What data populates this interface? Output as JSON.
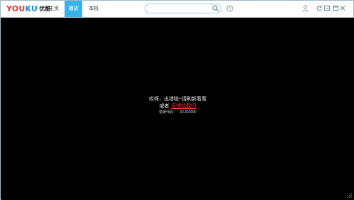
{
  "app": {
    "logo_latin_y": "YOU",
    "logo_latin_k": "KU",
    "logo_cn": "优酷",
    "brand_red": "#e5312e",
    "brand_blue": "#1b8fdc",
    "accent": "#38b2ea"
  },
  "nav": {
    "items": [
      {
        "label": "主页",
        "active": false
      },
      {
        "label": "播放",
        "active": true
      },
      {
        "label": "本机",
        "active": false
      }
    ]
  },
  "search": {
    "value": ""
  },
  "icons": {
    "search": "search-icon",
    "history": "clock-icon",
    "user": "user-icon",
    "refresh": "refresh-icon",
    "minimize": "minimize-icon",
    "window": "window-icon",
    "close": "close-icon",
    "resize": "resize-grip-icon"
  },
  "player": {
    "error_line1": "哎呀，出错啦~请刷新看看",
    "error_line2_prefix": "或者",
    "feedback_link": "反馈给我们",
    "error_code_label": "错误代码：",
    "error_code_value": "30,302000"
  }
}
